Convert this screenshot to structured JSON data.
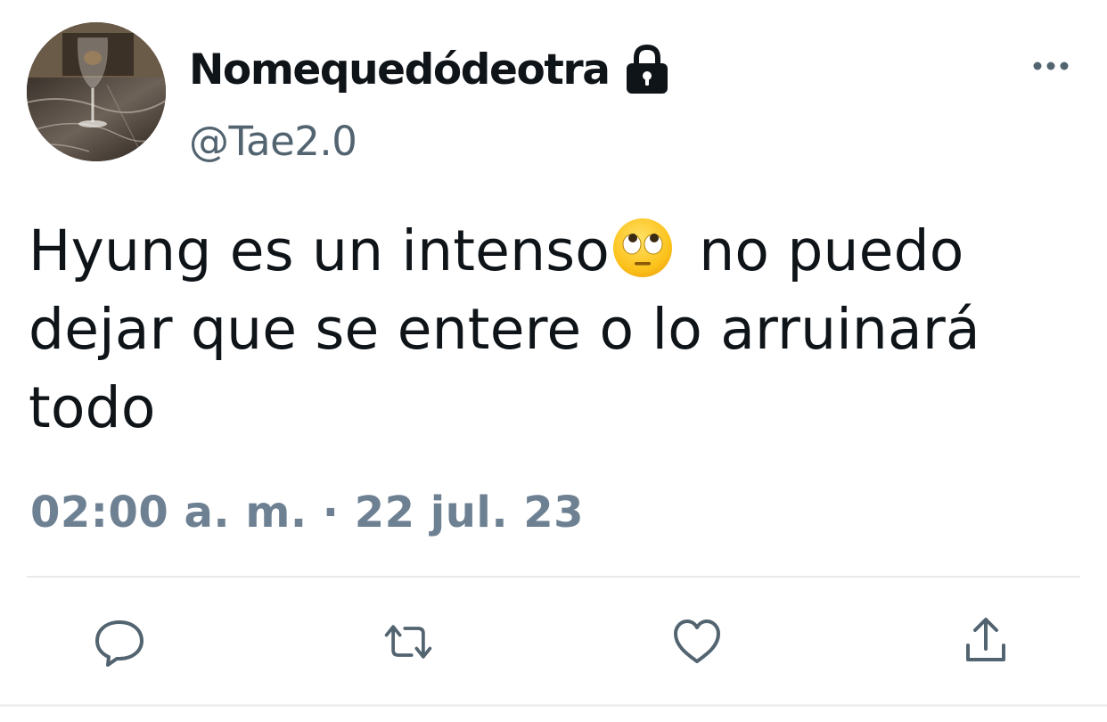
{
  "user": {
    "display_name": "Nomequedódeotra",
    "handle": "@Tae2.0",
    "protected_icon": "lock-icon",
    "avatar": "wine-glass-photo"
  },
  "menu": {
    "icon": "more-horizontal-icon"
  },
  "tweet": {
    "line1_before_emoji": "Hyung es un intenso",
    "emoji": "face-with-rolling-eyes",
    "line1_after_emoji": " no puedo",
    "line2": "dejar que se entere o lo arruinará",
    "line3": "todo"
  },
  "meta": {
    "timestamp": "02:00 a. m. · 22 jul. 23"
  },
  "actions": [
    {
      "name": "reply",
      "icon": "reply-bubble-icon"
    },
    {
      "name": "retweet",
      "icon": "retweet-icon"
    },
    {
      "name": "like",
      "icon": "heart-icon"
    },
    {
      "name": "share",
      "icon": "share-icon"
    }
  ],
  "colors": {
    "text_primary": "#0f1419",
    "text_secondary": "#536471",
    "timestamp": "#6e8193",
    "icon": "#536471",
    "divider": "#e6e9eb"
  }
}
